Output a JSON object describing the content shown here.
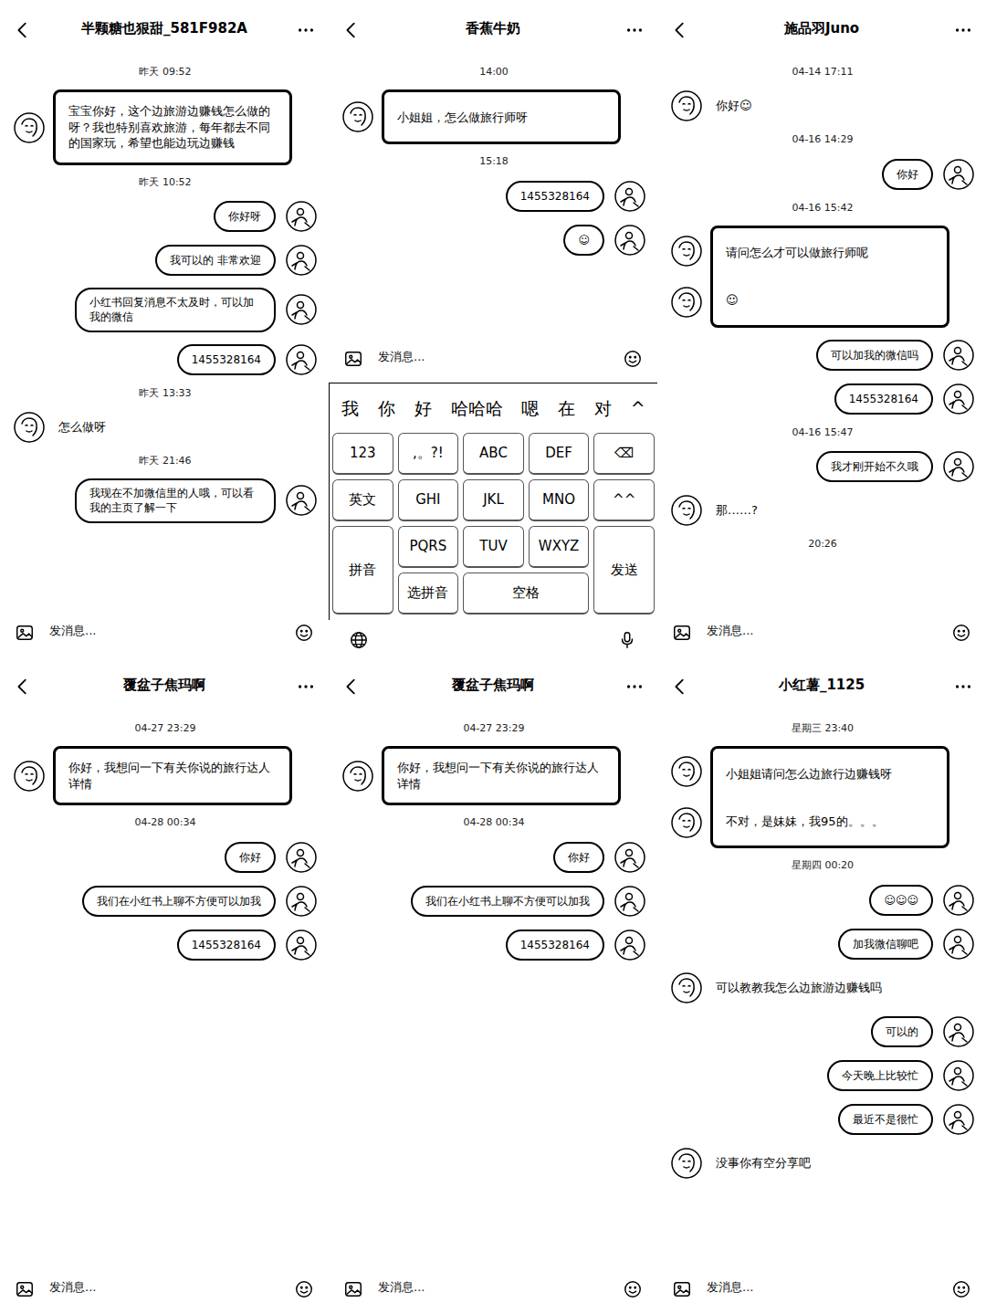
{
  "panels": [
    {
      "title": "半颗糖也狠甜_581F982A",
      "placeholder": "发消息...",
      "messages": [
        {
          "kind": "time",
          "text": "昨天 09:52"
        },
        {
          "kind": "boxed",
          "items": [
            "宝宝你好，这个边旅游边赚钱怎么做的呀？我也特别喜欢旅游，每年都去不同的国家玩，希望也能边玩边赚钱"
          ]
        },
        {
          "kind": "time",
          "text": "昨天 10:52"
        },
        {
          "kind": "out",
          "text": "你好呀"
        },
        {
          "kind": "out",
          "text": "我可以的 非常欢迎"
        },
        {
          "kind": "out",
          "text": "小红书回复消息不太及时，可以加我的微信"
        },
        {
          "kind": "out",
          "text": "1455328164"
        },
        {
          "kind": "time",
          "text": "昨天 13:33"
        },
        {
          "kind": "in",
          "text": "怎么做呀"
        },
        {
          "kind": "time",
          "text": "昨天 21:46"
        },
        {
          "kind": "out",
          "text": "我现在不加微信里的人哦，可以看我的主页了解一下"
        }
      ]
    },
    {
      "title": "香蕉牛奶",
      "placeholder": "发消息...",
      "messages": [
        {
          "kind": "time",
          "text": "14:00"
        },
        {
          "kind": "boxed",
          "items": [
            "小姐姐，怎么做旅行师呀"
          ]
        },
        {
          "kind": "time",
          "text": "15:18"
        },
        {
          "kind": "out",
          "text": "1455328164"
        },
        {
          "kind": "out",
          "text": "☺"
        }
      ],
      "keyboard": {
        "suggestions": [
          "我",
          "你",
          "好",
          "哈哈哈",
          "嗯",
          "在",
          "对",
          "^"
        ],
        "keys": [
          "123",
          ",。?!",
          "ABC",
          "DEF",
          "⌫",
          "英文",
          "GHI",
          "JKL",
          "MNO",
          "^^",
          "拼音",
          "PQRS",
          "TUV",
          "WXYZ",
          "发送",
          "选拼音",
          "空格"
        ]
      }
    },
    {
      "title": "施品羽Juno",
      "placeholder": "发消息...",
      "messages": [
        {
          "kind": "time",
          "text": "04-14 17:11"
        },
        {
          "kind": "in",
          "text": "你好☺"
        },
        {
          "kind": "time",
          "text": "04-16 14:29"
        },
        {
          "kind": "out",
          "text": "你好"
        },
        {
          "kind": "time",
          "text": "04-16 15:42"
        },
        {
          "kind": "boxed",
          "items": [
            "请问怎么才可以做旅行师呢",
            "☺"
          ]
        },
        {
          "kind": "out",
          "text": "可以加我的微信吗"
        },
        {
          "kind": "out",
          "text": "1455328164"
        },
        {
          "kind": "time",
          "text": "04-16 15:47"
        },
        {
          "kind": "out",
          "text": "我才刚开始不久哦"
        },
        {
          "kind": "in",
          "text": "那……?"
        },
        {
          "kind": "time",
          "text": "20:26"
        }
      ]
    },
    {
      "title": "覆盆子焦玛啊",
      "placeholder": "发消息...",
      "messages": [
        {
          "kind": "time",
          "text": "04-27 23:29"
        },
        {
          "kind": "boxed",
          "items": [
            "你好，我想问一下有关你说的旅行达人详情"
          ]
        },
        {
          "kind": "time",
          "text": "04-28 00:34"
        },
        {
          "kind": "out",
          "text": "你好"
        },
        {
          "kind": "out",
          "text": "我们在小红书上聊不方便可以加我"
        },
        {
          "kind": "out",
          "text": "1455328164"
        }
      ]
    },
    {
      "title": "覆盆子焦玛啊",
      "placeholder": "发消息...",
      "messages": [
        {
          "kind": "time",
          "text": "04-27 23:29"
        },
        {
          "kind": "boxed",
          "items": [
            "你好，我想问一下有关你说的旅行达人详情"
          ]
        },
        {
          "kind": "time",
          "text": "04-28 00:34"
        },
        {
          "kind": "out",
          "text": "你好"
        },
        {
          "kind": "out",
          "text": "我们在小红书上聊不方便可以加我"
        },
        {
          "kind": "out",
          "text": "1455328164"
        }
      ]
    },
    {
      "title": "小红薯_1125",
      "placeholder": "发消息...",
      "messages": [
        {
          "kind": "time",
          "text": "星期三 23:40"
        },
        {
          "kind": "boxed",
          "items": [
            "小姐姐请问怎么边旅行边赚钱呀",
            "不对，是妹妹，我95的。。。"
          ]
        },
        {
          "kind": "time",
          "text": "星期四 00:20"
        },
        {
          "kind": "out",
          "text": "☺☺☺"
        },
        {
          "kind": "out",
          "text": "加我微信聊吧"
        },
        {
          "kind": "in",
          "text": "可以教教我怎么边旅游边赚钱吗"
        },
        {
          "kind": "out",
          "text": "可以的"
        },
        {
          "kind": "out",
          "text": "今天晚上比较忙"
        },
        {
          "kind": "out",
          "text": "最近不是很忙"
        },
        {
          "kind": "in",
          "text": "没事你有空分享吧"
        }
      ]
    }
  ]
}
